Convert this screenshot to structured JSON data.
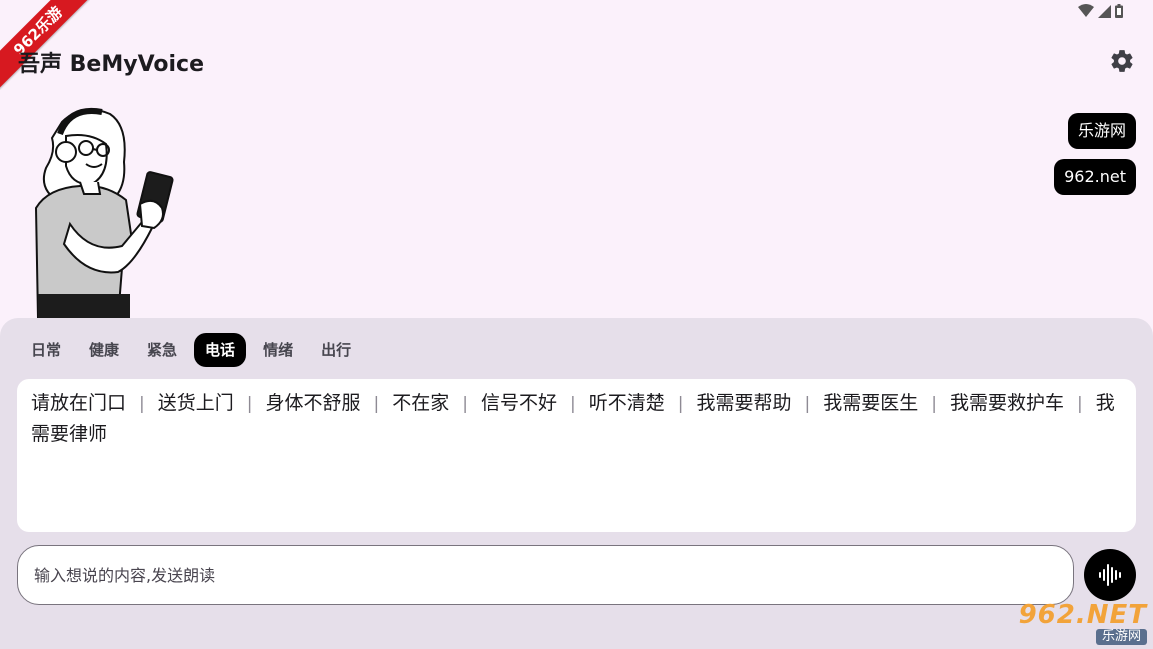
{
  "app": {
    "title": "吾声 BeMyVoice"
  },
  "corner_badge": {
    "label": "962乐游"
  },
  "chips": [
    "乐游网",
    "962.net"
  ],
  "tabs": [
    {
      "label": "日常",
      "active": false
    },
    {
      "label": "健康",
      "active": false
    },
    {
      "label": "紧急",
      "active": false
    },
    {
      "label": "电话",
      "active": true
    },
    {
      "label": "情绪",
      "active": false
    },
    {
      "label": "出行",
      "active": false
    }
  ],
  "phrases": [
    "请放在门口",
    "送货上门",
    "身体不舒服",
    "不在家",
    "信号不好",
    "听不清楚",
    "我需要帮助",
    "我需要医生",
    "我需要救护车",
    "我需要律师"
  ],
  "input": {
    "placeholder": "输入想说的内容,发送朗读",
    "value": ""
  },
  "watermark": {
    "main": "962.NET",
    "sub": "乐游网"
  },
  "icons": {
    "settings": "gear-icon",
    "voice": "sound-wave-icon",
    "wifi": "wifi-icon",
    "signal": "signal-icon",
    "battery": "battery-icon"
  },
  "colors": {
    "background": "#fbf1fb",
    "panel": "#e6dfea",
    "accent": "#000000",
    "badge": "#d71920"
  }
}
